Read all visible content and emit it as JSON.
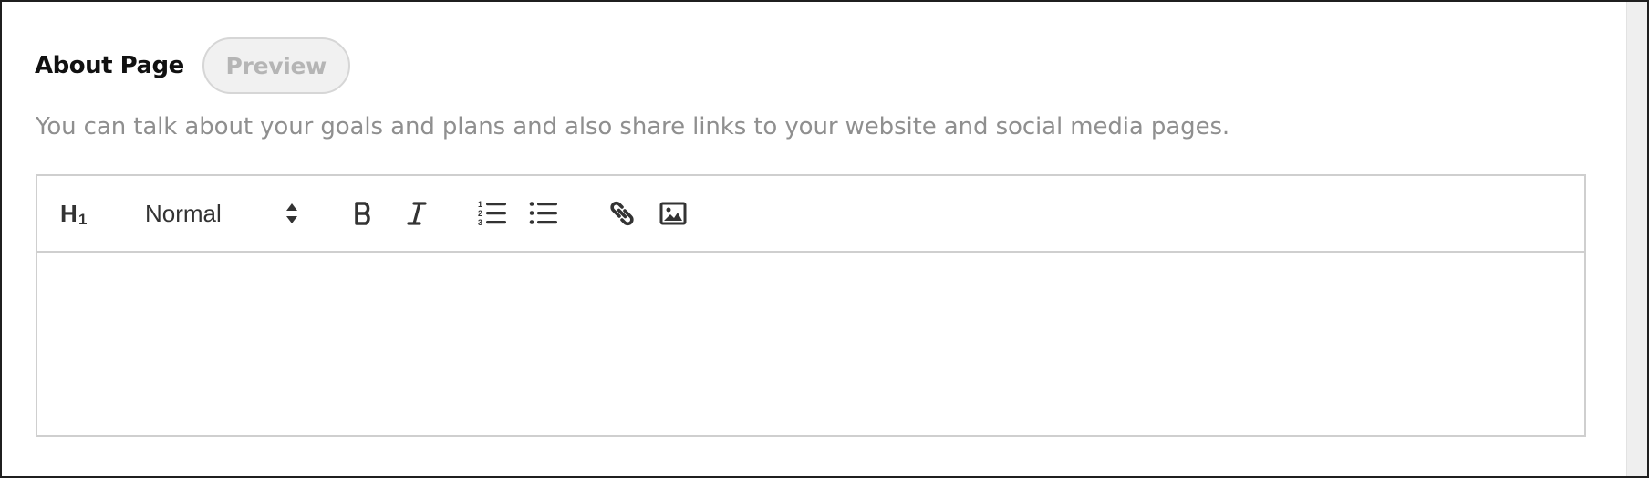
{
  "section": {
    "title": "About Page",
    "preview_label": "Preview",
    "description": "You can talk about your goals and plans and also share links to your website and social media pages."
  },
  "toolbar": {
    "heading_icon": "heading-1-icon",
    "block_type": {
      "selected": "Normal"
    },
    "buttons": [
      {
        "icon": "bold-icon"
      },
      {
        "icon": "italic-icon"
      },
      {
        "icon": "ordered-list-icon"
      },
      {
        "icon": "unordered-list-icon"
      },
      {
        "icon": "link-icon"
      },
      {
        "icon": "image-icon"
      }
    ]
  },
  "editor": {
    "content": ""
  },
  "colors": {
    "text": "#111111",
    "muted_text": "#8f8f8f",
    "icon": "#333333",
    "border": "#cfcfcf",
    "preview_bg": "#f1f1f1",
    "preview_text": "#b5b5b5"
  }
}
